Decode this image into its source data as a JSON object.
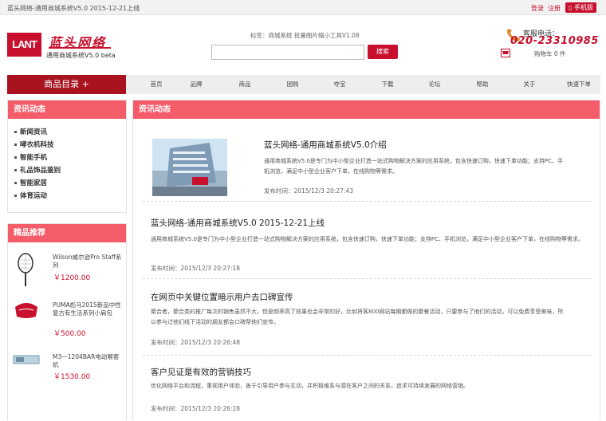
{
  "topbar": {
    "notice": "蓝头网络-通用商城系统V5.0 2015-12-21上线",
    "login": "登录",
    "register": "注册",
    "mobile": "手机版"
  },
  "logo": {
    "badge": "LANT",
    "brand": "蓝头网络",
    "sub": "通用商城系统V5.0 beta"
  },
  "search": {
    "hot": "标签：商城系统 批量图片缩小工具V1.08",
    "placeholder": "",
    "button": "搜索"
  },
  "contact": {
    "label": "客服电话：",
    "phone": "020-23310985",
    "cart": "购物车 0 件"
  },
  "nav": {
    "category": "商品目录 +",
    "items": [
      "首页",
      "品牌",
      "商品",
      "团购",
      "夺宝",
      "下载",
      "论坛",
      "帮助",
      "关于",
      "快速下单"
    ]
  },
  "sidebar": {
    "news_title": "资讯动态",
    "news_items": [
      "新闻资讯",
      "哮衣机科技",
      "智能手机",
      "礼品饰品鉴别",
      "智能家居",
      "体育运动"
    ],
    "rec_title": "精品推荐",
    "products": [
      {
        "name": "Wilson威尔逊Pro Staff系列",
        "price": "￥1200.00"
      },
      {
        "name": "PUMA彪马2015新品中性复古有生活系列小肩包",
        "price": "￥500.00"
      },
      {
        "name": "M3一1204BAR电动喉套机",
        "price": "￥1530.00"
      }
    ]
  },
  "main": {
    "title": "资讯动态",
    "articles": [
      {
        "title": "蓝头网络-通用商城系统V5.0介绍",
        "desc": "通用商城系统V5.0是专门为中小型企业打造一站式购物解决方案的应用系统，包含快速订购，快速下单功能；支持PC、手机浏览，满足中小型企业客户下单，在线购物等需求。",
        "time": "发布时间：2015/12/3 20:27:43"
      },
      {
        "title": "蓝头网络-通用商城系统V5.0 2015-12-21上线",
        "desc": "通用商城系统V5.0是专门为中小型企业打造一站式购物解决方案的应用系统，包含快速订购，快速下单功能；支持PC、手机浏览，满足中小型企业客户下单，在线购物等需求。",
        "time": "发布时间：2015/12/3 20:27:18"
      },
      {
        "title": "在网页中关键位置暗示用户去口碑宣传",
        "desc": "聚合者，聚合类的推广每次的销售虽然不大，但是频率高了效果也会非常的好，比如将客800网站每期都做的聚餐活动，只要参与了他们的活动，可以免费享受美味，所以参与过他们线下活动的朋友都会口碑帮他们宣传。",
        "time": "发布时间：2015/12/3 20:26:48"
      },
      {
        "title": "客户见证是有效的营销技巧",
        "desc": "优化网络平台和流程，重视用户体验，善于引导用户参与互动，并积极维系与潜在客户之间的关系，追求可持续发展的网络营销。",
        "time": "发布时间：2015/12/3 20:26:28"
      }
    ]
  },
  "colors": {
    "brand_red": "#c8102e",
    "dark_red": "#a8131f",
    "panel_head": "#f45c6a"
  }
}
